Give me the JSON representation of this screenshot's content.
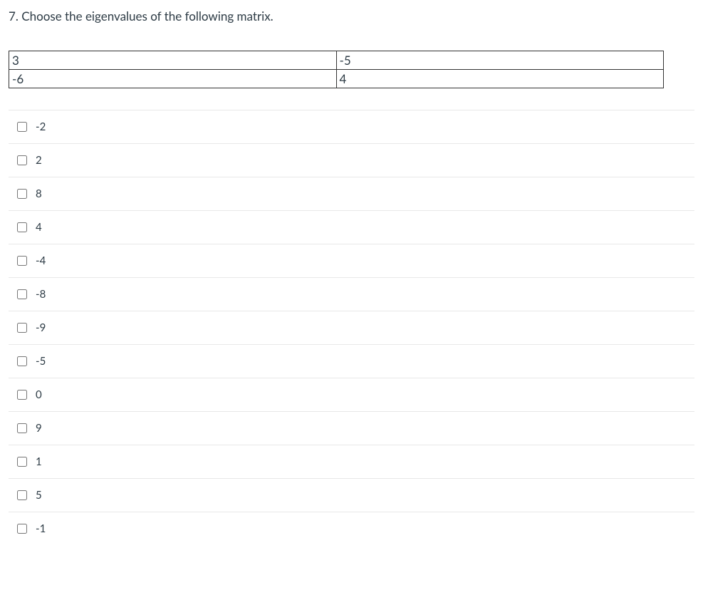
{
  "question": {
    "number": "7.",
    "text": "Choose the eigenvalues of the following matrix."
  },
  "matrix": {
    "r0c0": "3",
    "r0c1": "-5",
    "r1c0": "-6",
    "r1c1": "4"
  },
  "options": [
    {
      "label": "-2"
    },
    {
      "label": "2"
    },
    {
      "label": "8"
    },
    {
      "label": "4"
    },
    {
      "label": "-4"
    },
    {
      "label": "-8"
    },
    {
      "label": "-9"
    },
    {
      "label": "-5"
    },
    {
      "label": "0"
    },
    {
      "label": "9"
    },
    {
      "label": "1"
    },
    {
      "label": "5"
    },
    {
      "label": "-1"
    }
  ]
}
